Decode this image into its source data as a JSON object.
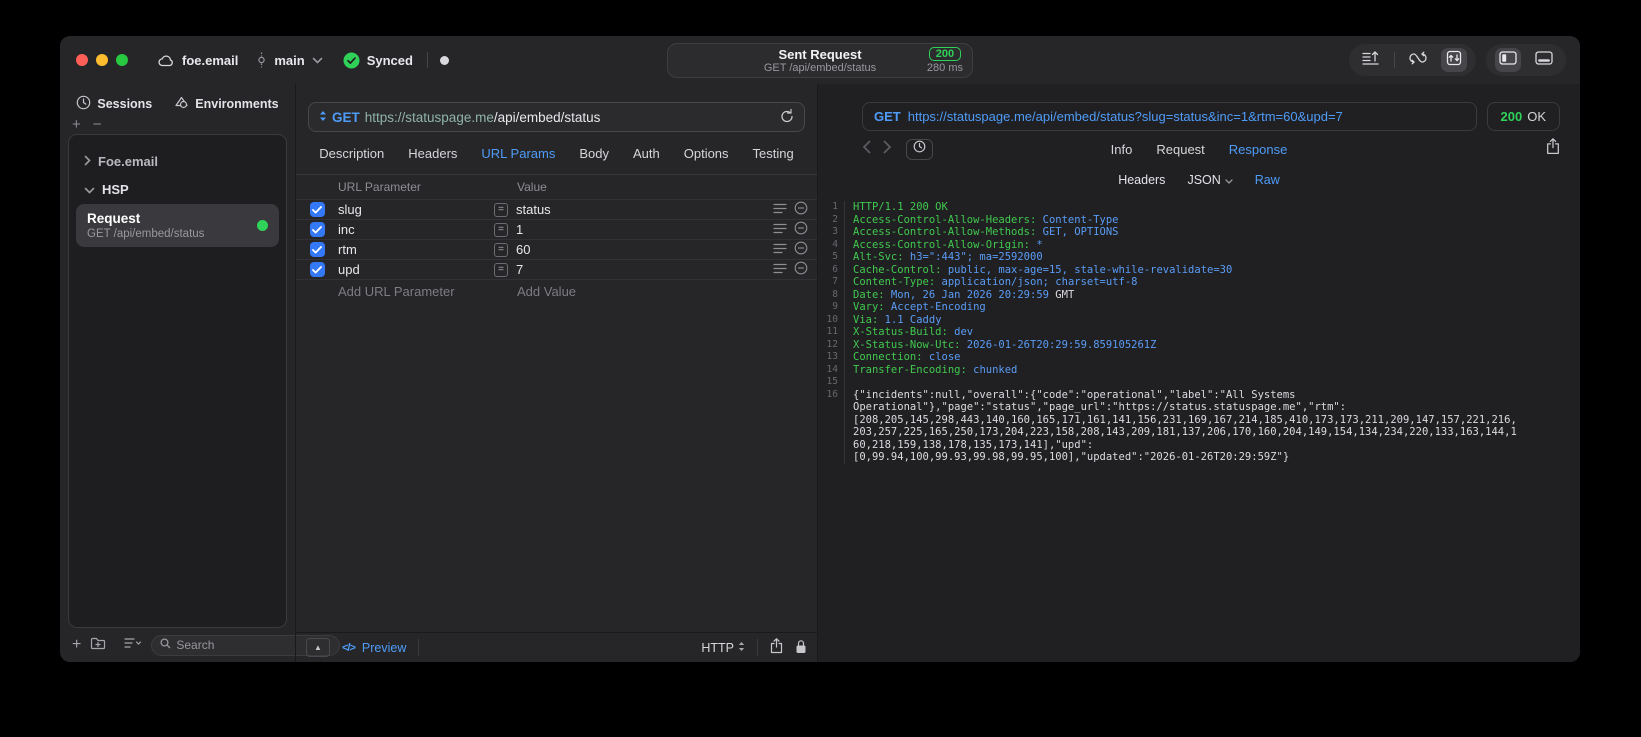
{
  "colors": {
    "accent_blue": "#4f9cf8",
    "status_green": "#30d158",
    "syntax_green": "#40c94e",
    "syntax_blue": "#5a9cf6",
    "checkbox_blue": "#3478F6"
  },
  "titlebar": {
    "project": "foe.email",
    "branch": "main",
    "sync_status": "Synced",
    "request_title": "Sent Request",
    "request_subtitle": "GET /api/embed/status",
    "status_code": "200",
    "duration": "280 ms"
  },
  "sidebar": {
    "tabs": [
      {
        "label": "Sessions",
        "icon": "clock-icon"
      },
      {
        "label": "Environments",
        "icon": "layers-icon"
      }
    ],
    "groups": [
      {
        "label": "Foe.email",
        "expanded": false
      },
      {
        "label": "HSP",
        "expanded": true
      }
    ],
    "request_item": {
      "title": "Request",
      "subtitle": "GET /api/embed/status",
      "selected": true,
      "status_dot": "green"
    },
    "search_placeholder": "Search"
  },
  "request_editor": {
    "method": "GET",
    "url_host": "https://statuspage.me",
    "url_path": "/api/embed/status",
    "tabs": [
      "Description",
      "Headers",
      "URL Params",
      "Body",
      "Auth",
      "Options",
      "Testing"
    ],
    "active_tab": "URL Params",
    "param_table": {
      "columns": [
        "URL Parameter",
        "Value"
      ],
      "rows": [
        {
          "checked": true,
          "name": "slug",
          "value": "status"
        },
        {
          "checked": true,
          "name": "inc",
          "value": "1"
        },
        {
          "checked": true,
          "name": "rtm",
          "value": "60"
        },
        {
          "checked": true,
          "name": "upd",
          "value": "7"
        }
      ],
      "add_name_placeholder": "Add URL Parameter",
      "add_value_placeholder": "Add Value"
    },
    "footer": {
      "preview_label": "Preview",
      "protocol": "HTTP"
    }
  },
  "response_viewer": {
    "method": "GET",
    "url": "https://statuspage.me/api/embed/status?slug=status&inc=1&rtm=60&upd=7",
    "status_code": "200",
    "status_text": "OK",
    "tabs": [
      "Info",
      "Request",
      "Response"
    ],
    "active_tab": "Response",
    "format_tabs": [
      "Headers",
      "JSON",
      "Raw"
    ],
    "active_format": "Raw",
    "body_lines": [
      {
        "n": "1",
        "parts": [
          {
            "c": "g",
            "t": "HTTP/1.1 200 OK"
          }
        ]
      },
      {
        "n": "2",
        "parts": [
          {
            "c": "g",
            "t": "Access-Control-Allow-Headers:"
          },
          {
            "c": "b",
            "t": " Content-Type"
          }
        ]
      },
      {
        "n": "3",
        "parts": [
          {
            "c": "g",
            "t": "Access-Control-Allow-Methods:"
          },
          {
            "c": "b",
            "t": " GET, OPTIONS"
          }
        ]
      },
      {
        "n": "4",
        "parts": [
          {
            "c": "g",
            "t": "Access-Control-Allow-Origin:"
          },
          {
            "c": "b",
            "t": " *"
          }
        ]
      },
      {
        "n": "5",
        "parts": [
          {
            "c": "g",
            "t": "Alt-Svc:"
          },
          {
            "c": "b",
            "t": " h3=\":443\"; ma=2592000"
          }
        ]
      },
      {
        "n": "6",
        "parts": [
          {
            "c": "g",
            "t": "Cache-Control:"
          },
          {
            "c": "b",
            "t": " public, max-age=15, stale-while-revalidate=30"
          }
        ]
      },
      {
        "n": "7",
        "parts": [
          {
            "c": "g",
            "t": "Content-Type:"
          },
          {
            "c": "b",
            "t": " application/json; charset=utf-8"
          }
        ]
      },
      {
        "n": "8",
        "parts": [
          {
            "c": "g",
            "t": "Date:"
          },
          {
            "c": "b",
            "t": " Mon, 26 Jan 2026 20:29:59"
          },
          {
            "c": "w",
            "t": " GMT"
          }
        ]
      },
      {
        "n": "9",
        "parts": [
          {
            "c": "g",
            "t": "Vary:"
          },
          {
            "c": "b",
            "t": " Accept-Encoding"
          }
        ]
      },
      {
        "n": "10",
        "parts": [
          {
            "c": "g",
            "t": "Via:"
          },
          {
            "c": "b",
            "t": " 1.1 Caddy"
          }
        ]
      },
      {
        "n": "11",
        "parts": [
          {
            "c": "g",
            "t": "X-Status-Build:"
          },
          {
            "c": "b",
            "t": " dev"
          }
        ]
      },
      {
        "n": "12",
        "parts": [
          {
            "c": "g",
            "t": "X-Status-Now-Utc:"
          },
          {
            "c": "b",
            "t": " 2026-01-26T20:29:59.859105261Z"
          }
        ]
      },
      {
        "n": "13",
        "parts": [
          {
            "c": "g",
            "t": "Connection:"
          },
          {
            "c": "b",
            "t": " close"
          }
        ]
      },
      {
        "n": "14",
        "parts": [
          {
            "c": "g",
            "t": "Transfer-Encoding:"
          },
          {
            "c": "b",
            "t": " chunked"
          }
        ]
      },
      {
        "n": "15",
        "parts": []
      },
      {
        "n": "16",
        "parts": [
          {
            "c": "w",
            "t": "{\"incidents\":null,\"overall\":{\"code\":\"operational\",\"label\":\"All Systems"
          }
        ]
      },
      {
        "n": "",
        "parts": [
          {
            "c": "w",
            "t": "Operational\"},\"page\":\"status\",\"page_url\":\"https://status.statuspage.me\",\"rtm\":"
          }
        ]
      },
      {
        "n": "",
        "parts": [
          {
            "c": "w",
            "t": "[208,205,145,298,443,140,160,165,171,161,141,156,231,169,167,214,185,410,173,173,211,209,147,157,221,216,"
          }
        ]
      },
      {
        "n": "",
        "parts": [
          {
            "c": "w",
            "t": "203,257,225,165,250,173,204,223,158,208,143,209,181,137,206,170,160,204,149,154,134,234,220,133,163,144,1"
          }
        ]
      },
      {
        "n": "",
        "parts": [
          {
            "c": "w",
            "t": "60,218,159,138,178,135,173,141],\"upd\":"
          }
        ]
      },
      {
        "n": "",
        "parts": [
          {
            "c": "w",
            "t": "[0,99.94,100,99.93,99.98,99.95,100],\"updated\":\"2026-01-26T20:29:59Z\"}"
          }
        ]
      }
    ]
  }
}
